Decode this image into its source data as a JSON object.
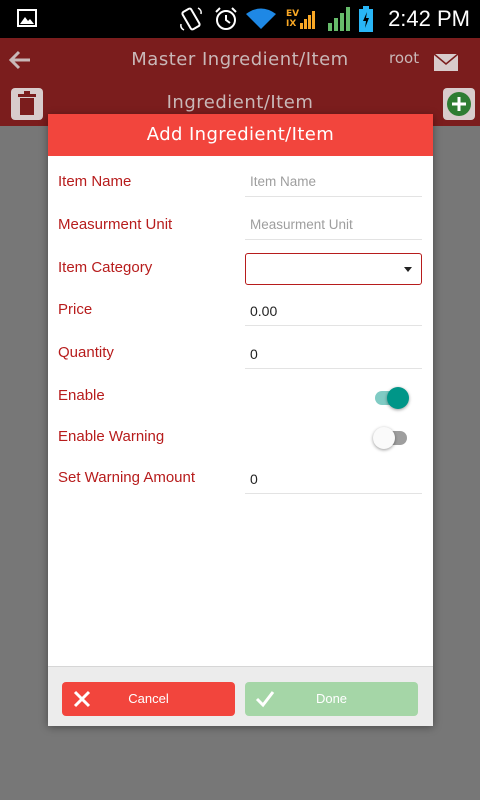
{
  "status_bar": {
    "time": "2:42 PM",
    "network_label_top": "EV",
    "network_label_bottom": "IX"
  },
  "app_bar": {
    "title": "Master Ingredient/Item",
    "subtitle": "Ingredient/Item",
    "user": "root"
  },
  "dialog": {
    "title": "Add Ingredient/Item",
    "fields": {
      "item_name": {
        "label": "Item Name",
        "placeholder": "Item Name",
        "value": ""
      },
      "measurement_unit": {
        "label": "Measurment Unit",
        "placeholder": "Measurment Unit",
        "value": ""
      },
      "item_category": {
        "label": "Item Category",
        "value": ""
      },
      "price": {
        "label": "Price",
        "value": "0.00"
      },
      "quantity": {
        "label": "Quantity",
        "value": "0"
      },
      "enable": {
        "label": "Enable",
        "on": true
      },
      "enable_warning": {
        "label": "Enable Warning",
        "on": false
      },
      "warning_amount": {
        "label": "Set Warning Amount",
        "value": "0"
      }
    },
    "buttons": {
      "cancel": "Cancel",
      "done": "Done"
    }
  },
  "colors": {
    "header": "#f2453d",
    "label": "#b71c1c",
    "toggle_on": "#009688",
    "cancel": "#f2453d",
    "done": "#a5d6a7"
  },
  "icons": [
    "image-icon",
    "rotate-icon",
    "alarm-icon",
    "wifi-icon",
    "signal-icon",
    "battery-icon",
    "back-arrow-icon",
    "mail-icon",
    "trash-icon",
    "add-icon",
    "close-icon",
    "check-icon"
  ]
}
